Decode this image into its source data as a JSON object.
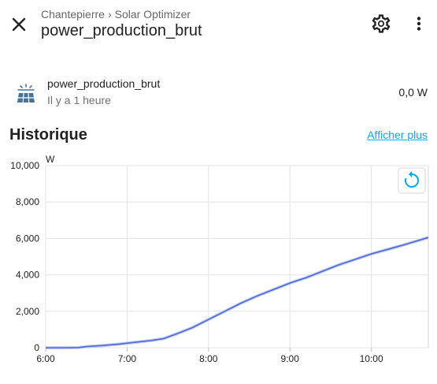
{
  "header": {
    "breadcrumb": [
      "Chantepierre",
      "Solar Optimizer"
    ],
    "breadcrumb_sep": "›",
    "title": "power_production_brut"
  },
  "icons": {
    "close": "close-icon",
    "settings": "gear-icon",
    "more": "more-vert-icon",
    "entity": "solar-panel-icon",
    "reset_zoom": "refresh-icon"
  },
  "entity": {
    "name": "power_production_brut",
    "last_changed": "Il y a 1 heure",
    "state": "0,0 W"
  },
  "history": {
    "title": "Historique",
    "show_more": "Afficher plus"
  },
  "colors": {
    "accent": "#03a9f4",
    "line": "#4a6ad8",
    "grid": "#e3e3e3"
  },
  "chart_data": {
    "type": "line",
    "ylabel": "W",
    "ylim": [
      0,
      10000
    ],
    "yticks": [
      "10,000",
      "8,000",
      "6,000",
      "4,000",
      "2,000",
      "0"
    ],
    "ytick_values": [
      10000,
      8000,
      6000,
      4000,
      2000,
      0
    ],
    "xticks": [
      "6:00",
      "7:00",
      "8:00",
      "9:00",
      "10:00"
    ],
    "xtick_values": [
      6,
      7,
      8,
      9,
      10
    ],
    "xlim": [
      6,
      10.7
    ],
    "grid": true,
    "series": [
      {
        "x": [
          6.0,
          6.25,
          6.4,
          6.5,
          6.7,
          6.9,
          7.1,
          7.3,
          7.45,
          7.6,
          7.8,
          8.0,
          8.2,
          8.4,
          8.6,
          8.8,
          9.0,
          9.2,
          9.4,
          9.6,
          9.8,
          10.0,
          10.2,
          10.4,
          10.7
        ],
        "y": [
          0,
          0,
          10,
          60,
          120,
          200,
          300,
          400,
          500,
          750,
          1100,
          1550,
          2000,
          2450,
          2850,
          3200,
          3550,
          3850,
          4200,
          4550,
          4850,
          5150,
          5400,
          5650,
          6050
        ]
      }
    ]
  }
}
